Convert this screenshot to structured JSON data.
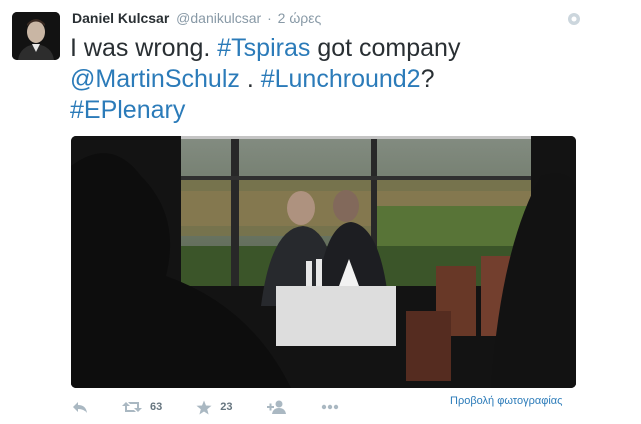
{
  "tweet": {
    "author_name": "Daniel Kulcsar",
    "handle": "@danikulcsar",
    "separator": "·",
    "time": "2 ώρες",
    "text_parts": [
      "I was wrong. ",
      "#Tspiras",
      " got company ",
      "@MartinSchulz",
      " . ",
      "#Lunchround2",
      "? ",
      "#EPlenary"
    ],
    "view_photo": "Προβολή φωτογραφίας"
  },
  "actions": {
    "retweets": "63",
    "favorites": "23"
  },
  "colors": {
    "link": "#2b7bb9",
    "text": "#292f33",
    "muted": "#8899a6",
    "icon": "#aab8c2"
  },
  "icons": [
    "reply-icon",
    "retweet-icon",
    "favorite-icon",
    "follow-icon",
    "more-icon"
  ]
}
